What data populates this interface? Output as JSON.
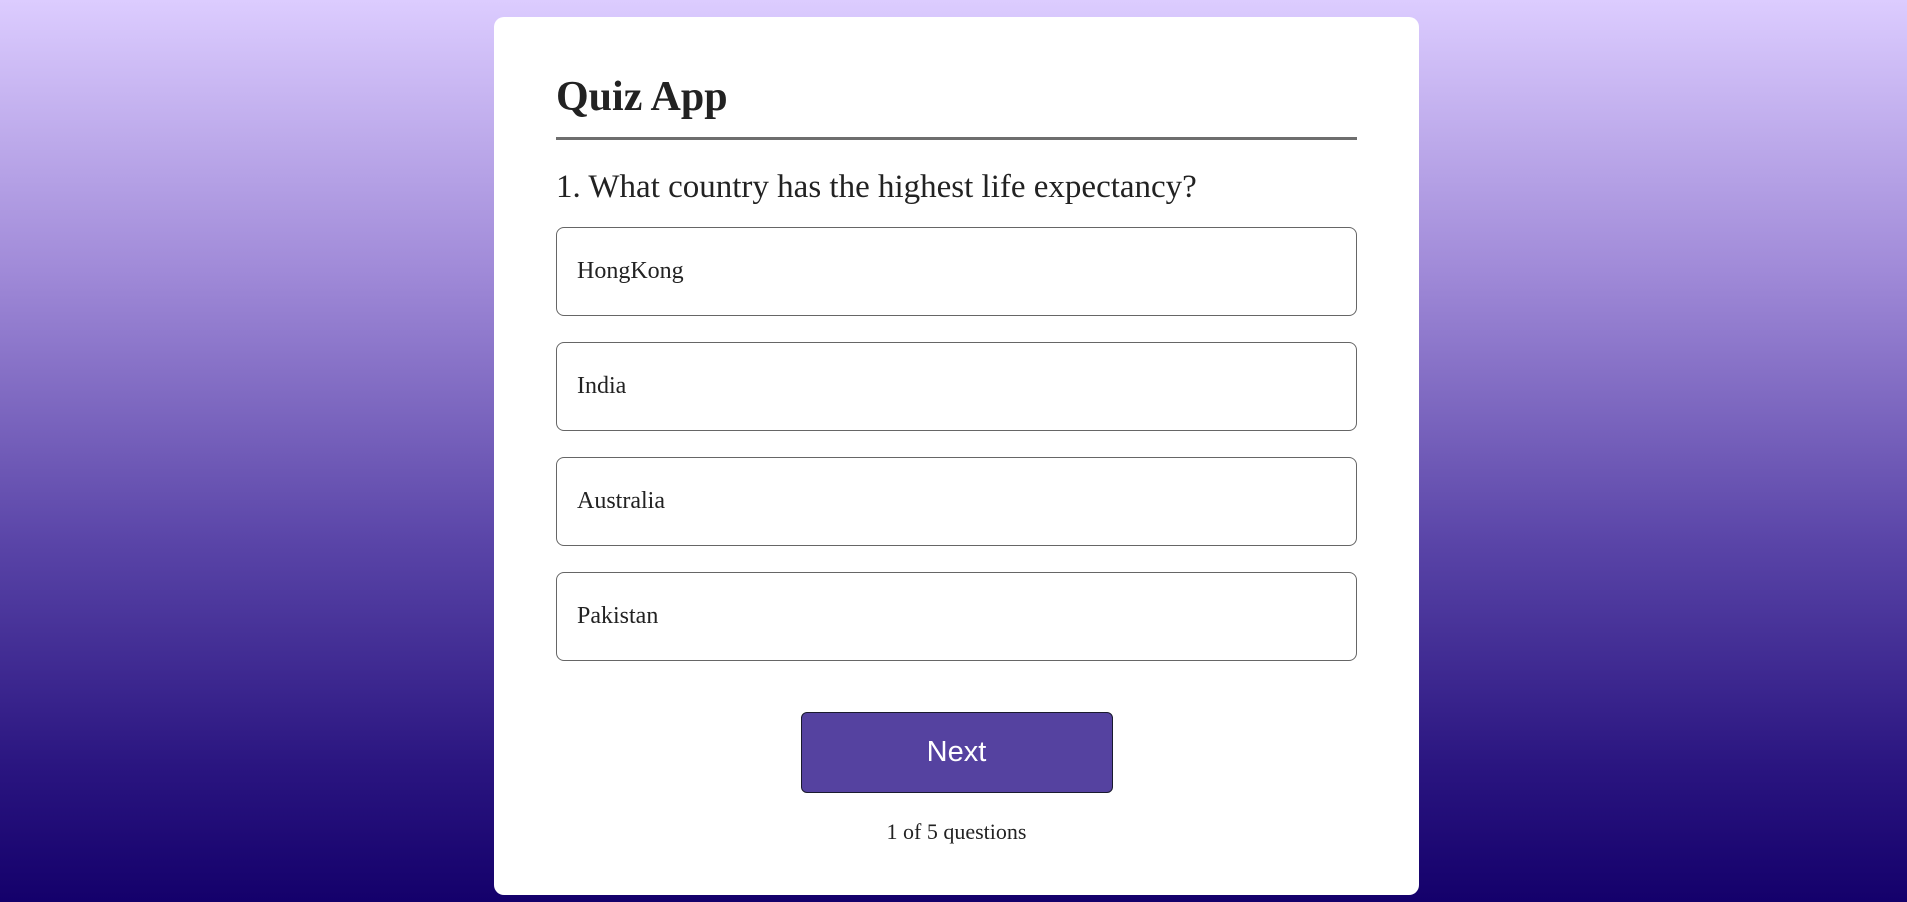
{
  "app": {
    "title": "Quiz App"
  },
  "quiz": {
    "question": "1. What country has the highest life expectancy?",
    "answers": [
      {
        "label": "HongKong"
      },
      {
        "label": "India"
      },
      {
        "label": "Australia"
      },
      {
        "label": "Pakistan"
      }
    ],
    "next_label": "Next",
    "progress_text": "1 of 5 questions"
  },
  "colors": {
    "button_bg": "#5542a0",
    "card_bg": "#ffffff",
    "gradient_top": "#dcccff",
    "gradient_bottom": "#14006b"
  }
}
